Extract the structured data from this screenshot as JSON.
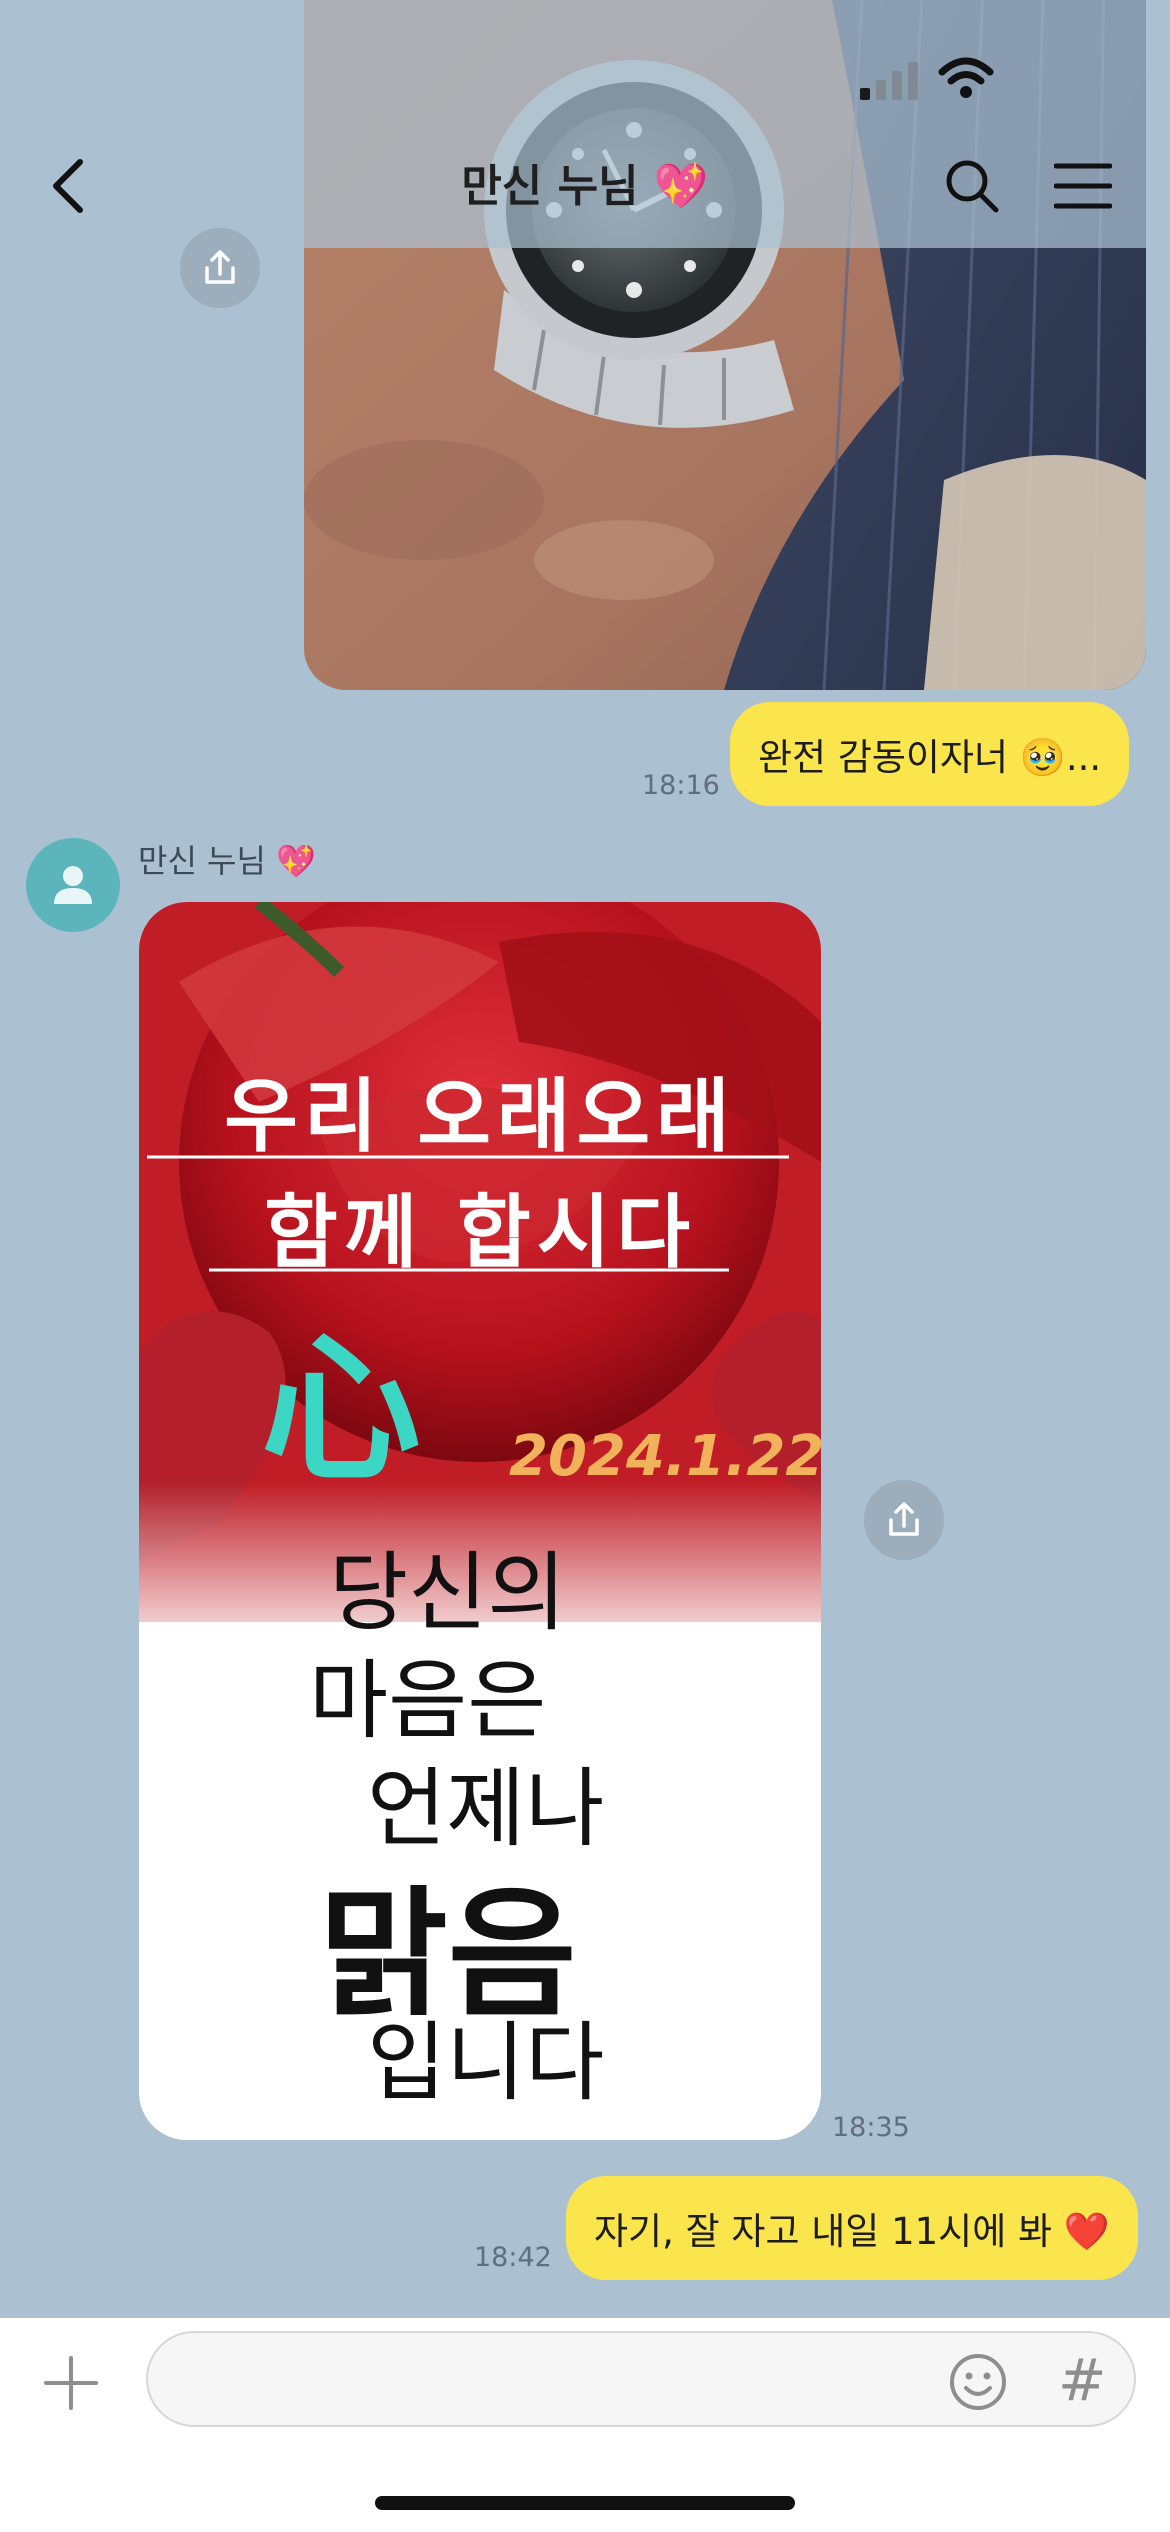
{
  "header": {
    "title": "만신 누님",
    "title_emoji": "💖"
  },
  "messages": {
    "sent_1": {
      "text": "완전 감동이자너 🥹...",
      "time": "18:16"
    },
    "received_sender": {
      "name": "만신 누님",
      "emoji": "💖"
    },
    "received_image": {
      "line_1": "우리 오래오래",
      "line_2": "함께 합시다",
      "glyph": "心",
      "date": "2024.1.22",
      "line_3": "당신의",
      "line_4": "마음은",
      "line_5": "언제나",
      "line_6": "맑음",
      "line_7": "입니다",
      "time": "18:35"
    },
    "sent_2": {
      "text": "자기, 잘 자고 내일 11시에 봐 ❤️",
      "time": "18:42"
    }
  },
  "icons": {
    "back": "chevron-left-icon",
    "search": "search-icon",
    "menu": "hamburger-menu-icon",
    "share": "share-icon",
    "plus": "plus-icon",
    "emoji": "emoji-icon",
    "hashtag": "hashtag-icon",
    "avatar": "default-profile-icon",
    "signal": "cellular-signal-icon",
    "wifi": "wifi-icon"
  },
  "input": {
    "placeholder": "",
    "hashtag_symbol": "#"
  },
  "colors": {
    "background": "#abc0d1",
    "sent_bubble": "#fbe54d",
    "avatar": "#5bb5bb",
    "received_card_accent": "#3cd6c4"
  }
}
